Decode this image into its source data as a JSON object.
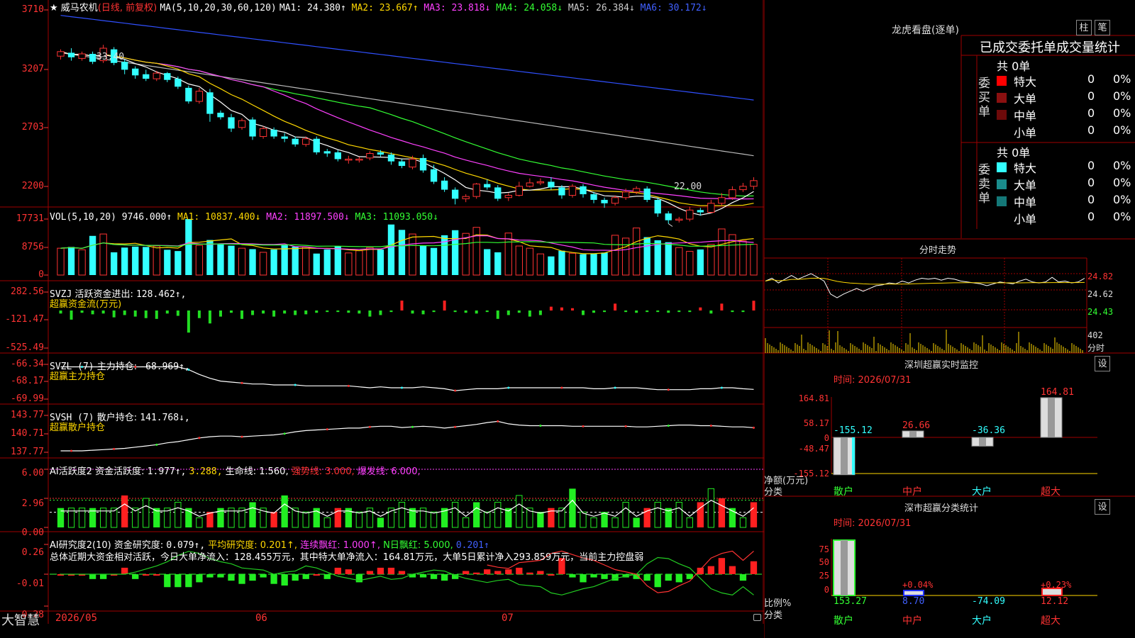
{
  "stock": {
    "star": "★",
    "name": "威马农机",
    "mode": "(日线, 前复权)",
    "ma_label": "MA(5,10,20,30,60,120)",
    "ma": [
      {
        "k": "MA1:",
        "v": "24.380",
        "a": "↑",
        "c": "#ffffff"
      },
      {
        "k": "MA2:",
        "v": "23.667",
        "a": "↑",
        "c": "#ffd800"
      },
      {
        "k": "MA3:",
        "v": "23.818",
        "a": "↓",
        "c": "#ff40ff"
      },
      {
        "k": "MA4:",
        "v": "24.058",
        "a": "↓",
        "c": "#33ff33"
      },
      {
        "k": "MA5:",
        "v": "26.384",
        "a": "↓",
        "c": "#cccccc"
      },
      {
        "k": "MA6:",
        "v": "30.172",
        "a": "↓",
        "c": "#4060ff"
      }
    ],
    "high_mark": "33.40",
    "low_mark": "22.00"
  },
  "axes": {
    "price": [
      "3710",
      "3207",
      "2703",
      "2200"
    ],
    "vol": [
      "17731",
      "8756",
      "0"
    ],
    "svzj": [
      "282.56",
      "-121.47",
      "-525.49"
    ],
    "svzl": [
      "-66.34",
      "-68.17",
      "-69.99"
    ],
    "svsh": [
      "143.77",
      "140.71",
      "137.77"
    ],
    "act": [
      "6.00",
      "2.96",
      "0.00"
    ],
    "res": [
      "0.26",
      "-0.01",
      "-0.28"
    ]
  },
  "vol_header": {
    "label": "VOL(5,10,20)",
    "value": "9746.000↑",
    "ma1": "MA1: 10837.400↓",
    "ma2": "MA2: 11897.500↓",
    "ma3": "MA3: 11093.050↓"
  },
  "svzj_header": {
    "label": "SVZJ",
    "name": "活跃资金进出:",
    "value": "128.462↑,",
    "sub": "超赢资金流(万元)"
  },
  "svzl_header": {
    "label": "SVZL (7)",
    "name": "主力持仓:",
    "value": "-68.969↑,",
    "sub": "超赢主力持仓"
  },
  "svsh_header": {
    "label": "SVSH (7)",
    "name": "散户持仓:",
    "value": "141.768↓,",
    "sub": "超赢散户持仓"
  },
  "act_header": {
    "label": "AI活跃度2",
    "name": "资金活跃度:",
    "value": "1.977↑,",
    "v2": "3.288,",
    "life": "生命线: 1.560,",
    "strong": "强势线: 3.000,",
    "burst": "爆发线: 6.000,"
  },
  "res_header": {
    "label": "AI研究度2(10)",
    "name": "资金研究度:",
    "value": "0.079↑,",
    "avg": "平均研究度: 0.201↑,",
    "cons": "连续飘红: 1.000↑,",
    "nday": "N日飘红: 5.000,",
    "v3": "0.201↑",
    "summary": "总体近期大资金相对活跃，今日大单净流入：128.455万元，其中特大单净流入：164.81万元，大单5日累计净入293.859万元，当前主力控盘弱"
  },
  "dates": {
    "a": "2026/05",
    "b": "06",
    "c": "07"
  },
  "footer": {
    "brand": "大智慧"
  },
  "side": {
    "title": "龙虎看盘(逐单)",
    "btn_bar": "柱",
    "btn_pen": "笔",
    "stat_title": "已成交委托单成交量统计",
    "buy_label": "委买单",
    "sell_label": "委卖单",
    "buy_total": "共 0单",
    "sell_total": "共 0单",
    "buy_rows": [
      {
        "name": "特大",
        "n": "0",
        "p": "0%",
        "c": "#ff0000"
      },
      {
        "name": "大单",
        "n": "0",
        "p": "0%",
        "c": "#8b1010"
      },
      {
        "name": "中单",
        "n": "0",
        "p": "0%",
        "c": "#6e0a0a"
      },
      {
        "name": "小单",
        "n": "0",
        "p": "0%",
        "c": "#000000"
      }
    ],
    "sell_rows": [
      {
        "name": "特大",
        "n": "0",
        "p": "0%",
        "c": "#33ffff"
      },
      {
        "name": "大单",
        "n": "0",
        "p": "0%",
        "c": "#1a8c8c"
      },
      {
        "name": "中单",
        "n": "0",
        "p": "0%",
        "c": "#147878"
      },
      {
        "name": "小单",
        "n": "0",
        "p": "0%",
        "c": "#000000"
      }
    ],
    "intraday_title": "分时走势",
    "intraday_y": [
      "24.82",
      "24.62",
      "24.43"
    ],
    "intraday_vol": "402",
    "intraday_lbl": "分时",
    "sz_title": "深圳超赢实时监控",
    "sz_set": "设",
    "sz_time": "时间: 2026/07/31",
    "sz_y": [
      "164.81",
      "58.17",
      "0",
      "-48.47",
      "-155.12"
    ],
    "sz_label_a": "净额(万元)",
    "sz_label_b": "分类",
    "sz_cats": [
      "散户",
      "中户",
      "大户",
      "超大"
    ],
    "sz_vals": [
      "-155.12",
      "26.66",
      "-36.36",
      "164.81"
    ],
    "sc_title": "深市超赢分类统计",
    "sc_set": "设",
    "sc_time": "时间: 2026/07/31",
    "sc_y": [
      "75",
      "50",
      "25",
      "0"
    ],
    "sc_label_a": "比例%",
    "sc_label_b": "分类",
    "sc_cats": [
      "散户",
      "中户",
      "大户",
      "超大"
    ],
    "sc_pcts": [
      "",
      "+0.04%",
      "",
      "+0.23%"
    ],
    "sc_vals": [
      "153.27",
      "8.70",
      "-74.09",
      "12.12"
    ]
  },
  "chart_data": {
    "type": "candlestick",
    "title": "威马农机",
    "candles": [
      [
        33.2,
        33.6,
        33.8,
        32.9
      ],
      [
        33.5,
        33.1,
        33.9,
        32.8
      ],
      [
        33.0,
        33.4,
        33.6,
        32.8
      ],
      [
        33.4,
        32.7,
        33.6,
        32.5
      ],
      [
        32.8,
        33.9,
        34.2,
        32.6
      ],
      [
        33.8,
        32.6,
        34.0,
        32.4
      ],
      [
        32.7,
        32.0,
        32.9,
        31.6
      ],
      [
        32.1,
        31.5,
        32.3,
        31.2
      ],
      [
        31.6,
        31.2,
        32.0,
        31.0
      ],
      [
        31.2,
        31.7,
        31.9,
        31.0
      ],
      [
        31.7,
        31.1,
        31.8,
        30.9
      ],
      [
        31.2,
        30.5,
        31.4,
        30.3
      ],
      [
        30.4,
        29.2,
        30.6,
        29.0
      ],
      [
        29.2,
        30.1,
        30.4,
        29.0
      ],
      [
        30.0,
        28.1,
        30.3,
        27.4
      ],
      [
        28.2,
        27.8,
        28.4,
        27.6
      ],
      [
        27.8,
        26.8,
        28.1,
        26.5
      ],
      [
        26.9,
        27.5,
        27.7,
        26.7
      ],
      [
        27.6,
        26.1,
        27.8,
        25.8
      ],
      [
        26.1,
        26.8,
        27.0,
        25.9
      ],
      [
        26.7,
        26.1,
        26.9,
        25.9
      ],
      [
        26.1,
        25.9,
        26.4,
        25.6
      ],
      [
        25.9,
        25.4,
        26.1,
        25.2
      ],
      [
        25.4,
        25.9,
        26.1,
        25.2
      ],
      [
        25.9,
        24.7,
        26.1,
        24.5
      ],
      [
        24.8,
        24.6,
        25.0,
        24.3
      ],
      [
        24.7,
        24.1,
        24.9,
        23.9
      ],
      [
        24.1,
        24.1,
        24.4,
        23.7
      ],
      [
        24.1,
        24.1,
        24.3,
        23.8
      ],
      [
        24.2,
        24.6,
        24.8,
        24.0
      ],
      [
        24.7,
        24.5,
        24.9,
        24.3
      ],
      [
        24.5,
        23.9,
        24.7,
        23.6
      ],
      [
        23.9,
        23.5,
        24.1,
        23.3
      ],
      [
        23.4,
        24.1,
        24.4,
        23.2
      ],
      [
        24.2,
        23.1,
        24.5,
        22.9
      ],
      [
        23.2,
        22.1,
        23.6,
        21.9
      ],
      [
        22.2,
        21.4,
        22.5,
        21.2
      ],
      [
        21.4,
        20.6,
        21.6,
        20.1
      ],
      [
        20.6,
        20.8,
        21.0,
        20.3
      ],
      [
        20.8,
        21.9,
        22.0,
        20.6
      ],
      [
        21.9,
        21.6,
        22.3,
        21.4
      ],
      [
        21.6,
        20.6,
        21.8,
        20.4
      ],
      [
        20.7,
        20.9,
        21.1,
        20.4
      ],
      [
        20.9,
        21.7,
        22.1,
        20.8
      ],
      [
        21.7,
        22.0,
        22.4,
        21.6
      ],
      [
        22.0,
        22.1,
        22.4,
        21.8
      ],
      [
        22.1,
        21.6,
        22.5,
        21.4
      ],
      [
        21.6,
        20.9,
        21.8,
        20.6
      ],
      [
        20.9,
        21.7,
        21.9,
        20.7
      ],
      [
        21.7,
        21.0,
        21.9,
        20.7
      ],
      [
        21.0,
        20.5,
        21.2,
        20.2
      ],
      [
        20.5,
        20.2,
        20.7,
        19.8
      ],
      [
        20.2,
        20.7,
        20.9,
        20.0
      ],
      [
        20.7,
        21.2,
        21.5,
        20.5
      ],
      [
        21.2,
        21.5,
        21.7,
        21.0
      ],
      [
        21.5,
        20.5,
        21.7,
        20.3
      ],
      [
        20.5,
        19.3,
        20.7,
        19.0
      ],
      [
        19.3,
        18.7,
        19.5,
        18.4
      ],
      [
        18.7,
        18.8,
        19.0,
        18.5
      ],
      [
        18.8,
        19.6,
        19.9,
        18.6
      ],
      [
        19.6,
        19.4,
        19.8,
        19.1
      ],
      [
        19.4,
        20.2,
        20.5,
        19.3
      ],
      [
        20.2,
        20.7,
        21.1,
        20.0
      ],
      [
        20.7,
        21.4,
        21.7,
        20.5
      ],
      [
        21.4,
        21.7,
        22.0,
        21.2
      ],
      [
        21.7,
        22.2,
        22.5,
        21.4
      ]
    ],
    "volume": [
      8500,
      8900,
      8000,
      12400,
      13000,
      7200,
      8700,
      9000,
      8900,
      9200,
      8000,
      7600,
      17731,
      9400,
      11100,
      9700,
      9300,
      8500,
      8200,
      7200,
      8100,
      9500,
      9000,
      8900,
      6800,
      8100,
      9100,
      7000,
      7700,
      8700,
      8100,
      16000,
      14300,
      13000,
      9300,
      8600,
      12600,
      14200,
      13200,
      15100,
      8200,
      7200,
      13300,
      9200,
      8500,
      6700,
      5900,
      7700,
      6900,
      6600,
      6700,
      7100,
      12600,
      11700,
      14900,
      12000,
      11000,
      10400,
      8700,
      7500,
      8100,
      9700,
      14600,
      12800,
      10800,
      9746
    ],
    "svzj": [
      -40,
      -120,
      -30,
      -50,
      -40,
      -90,
      -60,
      -80,
      -100,
      -110,
      -40,
      -70,
      -290,
      -100,
      -170,
      -80,
      -30,
      -110,
      -60,
      -40,
      -80,
      -40,
      -60,
      -50,
      -30,
      -20,
      -20,
      -30,
      -40,
      -80,
      -60,
      -20,
      130,
      -40,
      -50,
      -20,
      130,
      -20,
      -30,
      -40,
      -20,
      -110,
      -60,
      -30,
      -80,
      -60,
      50,
      40,
      30,
      -60,
      -30,
      -20,
      90,
      -20,
      -30,
      -20,
      -20,
      -30,
      -20,
      -20,
      40,
      -40,
      90,
      -20,
      -20,
      128
    ],
    "svzl": [
      -66.6,
      -66.6,
      -66.6,
      -66.6,
      -66.6,
      -66.6,
      -66.6,
      -66.6,
      -66.6,
      -66.6,
      -66.6,
      -66.6,
      -66.9,
      -67.4,
      -67.8,
      -68.1,
      -68.2,
      -68.3,
      -68.4,
      -68.4,
      -68.5,
      -68.5,
      -68.5,
      -68.6,
      -68.6,
      -68.6,
      -68.6,
      -68.6,
      -68.7,
      -68.8,
      -68.7,
      -68.8,
      -68.8,
      -68.8,
      -68.7,
      -68.8,
      -68.9,
      -69.1,
      -69.0,
      -68.9,
      -68.9,
      -68.9,
      -68.8,
      -68.8,
      -68.8,
      -68.8,
      -68.8,
      -68.8,
      -68.8,
      -68.8,
      -68.9,
      -68.9,
      -68.8,
      -68.8,
      -68.8,
      -68.9,
      -69.0,
      -69.0,
      -69.0,
      -69.0,
      -68.9,
      -68.9,
      -68.8,
      -68.8,
      -68.9,
      -68.97
    ],
    "svsh": [
      138.0,
      138.0,
      138.0,
      138.1,
      138.2,
      138.3,
      138.4,
      138.6,
      138.8,
      139.0,
      139.3,
      139.5,
      139.8,
      140.1,
      140.3,
      140.4,
      140.4,
      140.3,
      140.4,
      140.5,
      140.6,
      140.8,
      141.1,
      141.3,
      141.4,
      141.5,
      141.6,
      141.7,
      141.7,
      141.9,
      142.0,
      142.0,
      141.8,
      141.9,
      142.0,
      141.9,
      141.7,
      141.9,
      142.1,
      142.3,
      142.6,
      142.8,
      142.4,
      142.2,
      142.1,
      142.1,
      142.1,
      142.1,
      142.0,
      142.0,
      142.0,
      142.0,
      142.0,
      142.0,
      141.9,
      141.9,
      142.0,
      142.1,
      142.2,
      142.2,
      142.1,
      142.1,
      142.0,
      141.9,
      141.9,
      141.77
    ],
    "activity": [
      2,
      2,
      2,
      2,
      2,
      2,
      3.3,
      2,
      3,
      2,
      2,
      2.6,
      2,
      1,
      1.6,
      2,
      2,
      2,
      2.6,
      2,
      1.6,
      3.3,
      2,
      1.6,
      2,
      1,
      2,
      2,
      1.6,
      2,
      1,
      2,
      2.6,
      2,
      2,
      1.6,
      2,
      2.6,
      1,
      2.6,
      1.6,
      2.6,
      2,
      3.3,
      2,
      1.6,
      2,
      2,
      4,
      1.6,
      1,
      1.6,
      1,
      2.6,
      1,
      2,
      2.6,
      2,
      2.6,
      1,
      2.6,
      4,
      3,
      2,
      1,
      2.6
    ],
    "act_red": [
      6,
      14,
      20,
      26,
      46,
      55,
      60,
      62,
      65
    ],
    "research": [
      0,
      0,
      0,
      -0.03,
      -0.03,
      0,
      0.04,
      -0.03,
      0,
      0,
      -0.08,
      -0.08,
      -0.08,
      -0.05,
      -0.02,
      -0.02,
      -0.04,
      -0.06,
      -0.04,
      -0.02,
      -0.06,
      -0.07,
      -0.04,
      -0.03,
      0,
      -0.03,
      0.04,
      0.03,
      -0.05,
      0.02,
      0.04,
      0.04,
      0.02,
      -0.02,
      -0.02,
      -0.03,
      -0.04,
      -0.03,
      0.02,
      0.01,
      0.03,
      0.02,
      0.03,
      0.04,
      0.01,
      0.02,
      0,
      0.1,
      -0.02,
      -0.05,
      -0.02,
      -0.03,
      -0.04,
      -0.02,
      -0.03,
      -0.04,
      -0.08,
      -0.04,
      -0.05,
      -0.03,
      0.04,
      0.05,
      0.1,
      0.05,
      -0.04,
      0.08
    ],
    "research_line": [
      0,
      0,
      0,
      0,
      0,
      0,
      0,
      -0.02,
      -0.05,
      -0.08,
      -0.12,
      -0.18,
      -0.22,
      -0.2,
      -0.15,
      -0.12,
      -0.1,
      -0.06,
      -0.05,
      -0.04,
      0,
      -0.02,
      -0.03,
      -0.08,
      -0.06,
      -0.02,
      0.02,
      0.04,
      0.06,
      0.04,
      0.02,
      0.05,
      0.04,
      0,
      -0.02,
      -0.04,
      -0.03,
      0.01,
      0.04,
      0.06,
      0.08,
      0.06,
      0.05,
      0.1,
      0.11,
      0.12,
      0.18,
      0.2,
      0.17,
      0.14,
      0.12,
      0.08,
      0.04,
      0.02,
      0,
      -0.1,
      -0.16,
      -0.15,
      -0.1,
      -0.06,
      0.04,
      0.14,
      0.18,
      0.2,
      0.12,
      0.2
    ],
    "intraday": [
      24.74,
      24.77,
      24.72,
      24.76,
      24.8,
      24.76,
      24.79,
      24.82,
      24.78,
      24.74,
      24.6,
      24.56,
      24.6,
      24.63,
      24.66,
      24.63,
      24.66,
      24.69,
      24.7,
      24.72,
      24.71,
      24.74,
      24.72,
      24.75,
      24.77,
      24.76,
      24.77,
      24.75,
      24.77,
      24.76,
      24.74,
      24.73,
      24.72,
      24.71,
      24.69,
      24.71,
      24.73,
      24.72,
      24.71,
      24.74,
      24.76,
      24.73,
      24.72,
      24.73,
      24.78,
      24.73,
      24.74,
      24.72,
      24.73,
      24.77
    ],
    "sz_values": [
      -155.12,
      26.66,
      -36.36,
      164.81
    ],
    "sc_values": [
      95,
      0.04,
      0,
      0.23
    ]
  }
}
